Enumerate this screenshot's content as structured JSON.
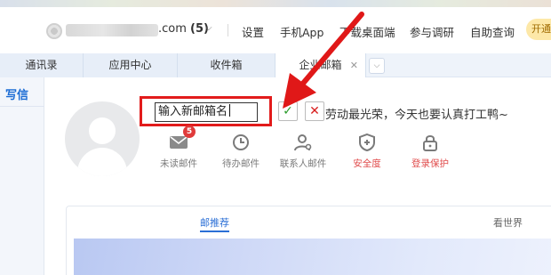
{
  "header": {
    "account_domain": ".com",
    "account_count": "(5)",
    "caret": "⌵",
    "nav": [
      "设置",
      "手机App",
      "下载桌面端",
      "参与调研",
      "自助查询"
    ],
    "open_button": "开通"
  },
  "tabs": [
    {
      "label": "通讯录"
    },
    {
      "label": "应用中心"
    },
    {
      "label": "收件箱"
    },
    {
      "label": "企业邮箱",
      "close": "✕"
    }
  ],
  "tabs_more": "⌵",
  "sidebar": {
    "compose": "写信"
  },
  "profile": {
    "name_input_value": "输入新邮箱名",
    "confirm_symbol": "✓",
    "cancel_symbol": "✕",
    "motto": "劳动最光荣，今天也要认真打工鸭~"
  },
  "quick_items": [
    {
      "label": "未读邮件",
      "badge": "5",
      "color": "#7a7a7a"
    },
    {
      "label": "待办邮件",
      "color": "#7a7a7a"
    },
    {
      "label": "联系人邮件",
      "color": "#7a7a7a"
    },
    {
      "label": "安全度",
      "color": "#e04b4b"
    },
    {
      "label": "登录保护",
      "color": "#e04b4b"
    }
  ],
  "card": {
    "tab_active": "邮推荐",
    "tab_other": "看世界"
  },
  "colors": {
    "accent_blue": "#2b6fd6",
    "highlight_red": "#e21b1b",
    "warning_red": "#e04b4b"
  }
}
